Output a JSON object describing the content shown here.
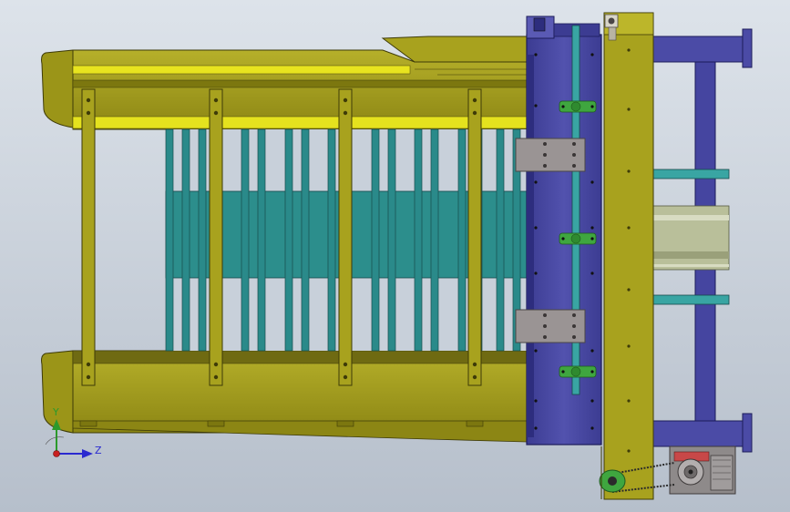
{
  "viewport": {
    "background_top": "#dde3ea",
    "background_bottom": "#b6bfcb"
  },
  "colors": {
    "frame_olive": "#a8a21e",
    "frame_olive_dark": "#6f6a12",
    "frame_yellow": "#e5e21e",
    "conveyor_teal": "#2a8a8a",
    "conveyor_teal_light": "#39a5a3",
    "plate_blue": "#4545a0",
    "plate_blue_dark": "#28287a",
    "bracket_gray": "#9a9494",
    "bearing_green": "#3fa63f",
    "motor_gray": "#8e8a8a"
  },
  "triad": {
    "axis_y": "Y",
    "axis_z": "Z",
    "icon": "coordinate-triad-icon"
  }
}
